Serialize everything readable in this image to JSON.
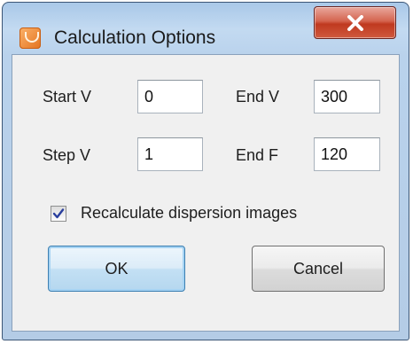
{
  "window": {
    "title": "Calculation Options",
    "close_symbol": "x"
  },
  "fields": {
    "start_v": {
      "label": "Start V",
      "value": "0"
    },
    "end_v": {
      "label": "End V",
      "value": "300"
    },
    "step_v": {
      "label": "Step V",
      "value": "1"
    },
    "end_f": {
      "label": "End F",
      "value": "120"
    }
  },
  "options": {
    "recalculate": {
      "label": "Recalculate dispersion images",
      "checked": true
    }
  },
  "buttons": {
    "ok": "OK",
    "cancel": "Cancel"
  },
  "colors": {
    "title_bar": "#b9d2ec",
    "close_button": "#c0391f",
    "dialog_body": "#f0f0f0",
    "default_button_border": "#3c7fb1"
  },
  "icons": {
    "app": "app-icon",
    "close": "close-icon",
    "check": "checkmark-icon"
  }
}
